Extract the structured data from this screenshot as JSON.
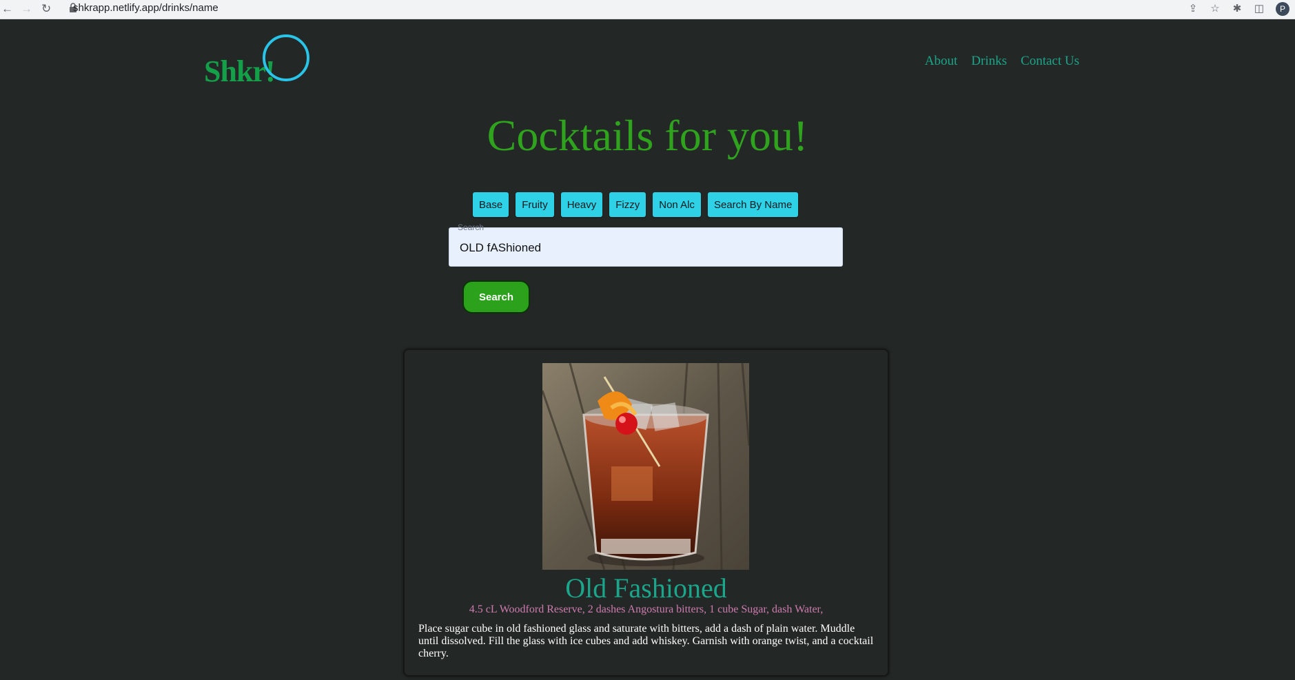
{
  "browser": {
    "url": "shkrapp.netlify.app/drinks/name",
    "profile_initial": "P"
  },
  "header": {
    "logo_text": "Shkr!",
    "nav": [
      "About",
      "Drinks",
      "Contact Us"
    ]
  },
  "hero": {
    "title": "Cocktails for you!"
  },
  "categories": [
    "Base",
    "Fruity",
    "Heavy",
    "Fizzy",
    "Non Alc",
    "Search By Name"
  ],
  "search": {
    "label": "Search",
    "value": "OLD fAShioned",
    "button_label": "Search"
  },
  "result": {
    "name": "Old Fashioned",
    "ingredients": "4.5 cL Woodford Reserve, 2 dashes Angostura bitters, 1 cube Sugar, dash Water,",
    "instructions": "Place sugar cube in old fashioned glass and saturate with bitters, add a dash of plain water. Muddle until dissolved. Fill the glass with ice cubes and add whiskey. Garnish with orange twist, and a cocktail cherry."
  },
  "colors": {
    "background": "#232826",
    "accent_green": "#2fa31e",
    "teal": "#1ba58a",
    "cyan_button": "#2ed1e6",
    "ingredient_pink": "#d07bb0"
  }
}
